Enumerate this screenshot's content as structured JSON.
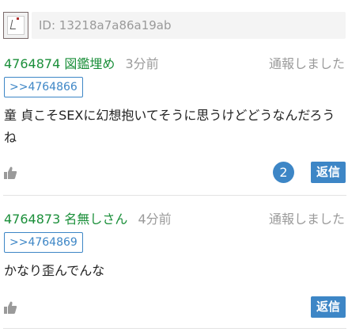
{
  "header": {
    "id_text": "ID: 13218a7a86a19ab"
  },
  "posts": [
    {
      "number": "4764874",
      "name": "図鑑埋め",
      "time": "3分前",
      "report": "通報しました",
      "anchor": ">>4764866",
      "body": "童 貞こそSEXに幻想抱いてそうに思うけどどうなんだろうね",
      "reply_count": "2",
      "reply_label": "返信"
    },
    {
      "number": "4764873",
      "name": "名無しさん",
      "time": "4分前",
      "report": "通報しました",
      "anchor": ">>4764869",
      "body": "かなり歪んでんな",
      "reply_label": "返信"
    }
  ],
  "colors": {
    "accent": "#3d86c6",
    "poster": "#1b8f3a",
    "muted": "#9a9a9a"
  }
}
